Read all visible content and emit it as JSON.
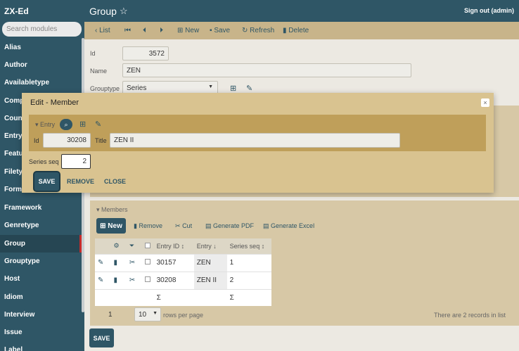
{
  "sidebar": {
    "brand": "ZX-Ed",
    "search_placeholder": "Search modules",
    "items": [
      {
        "label": "Alias"
      },
      {
        "label": "Author"
      },
      {
        "label": "Availabletype"
      },
      {
        "label": "Compa"
      },
      {
        "label": "Counti"
      },
      {
        "label": "Entry"
      },
      {
        "label": "Featu"
      },
      {
        "label": "Filetyp"
      },
      {
        "label": "Forma"
      },
      {
        "label": "Framework"
      },
      {
        "label": "Genretype"
      },
      {
        "label": "Group",
        "active": true
      },
      {
        "label": "Grouptype"
      },
      {
        "label": "Host"
      },
      {
        "label": "Idiom"
      },
      {
        "label": "Interview"
      },
      {
        "label": "Issue"
      },
      {
        "label": "Label"
      }
    ]
  },
  "header": {
    "title": "Group",
    "star": "☆",
    "signout": "Sign out (admin)"
  },
  "toolbar": {
    "list": "List",
    "new": "New",
    "save": "Save",
    "refresh": "Refresh",
    "delete": "Delete"
  },
  "form": {
    "id_label": "Id",
    "id_value": "3572",
    "name_label": "Name",
    "name_value": "ZEN",
    "grouptype_label": "Grouptype",
    "grouptype_value": "Series"
  },
  "dialog": {
    "title": "Edit - Member",
    "close": "×",
    "entry_label": "Entry",
    "id_label": "Id",
    "id_value": "30208",
    "title_label": "Title",
    "title_value": "ZEN II",
    "seriesseq_label": "Series seq",
    "seriesseq_value": "2",
    "save": "SAVE",
    "remove": "REMOVE",
    "close_btn": "CLOSE"
  },
  "members": {
    "heading": "Members",
    "new": "New",
    "remove": "Remove",
    "cut": "Cut",
    "pdf": "Generate PDF",
    "excel": "Generate Excel",
    "columns": {
      "entry_id": "Entry ID",
      "entry": "Entry",
      "series_seq": "Series seq"
    },
    "rows": [
      {
        "entry_id": "30157",
        "entry": "ZEN",
        "series_seq": "1"
      },
      {
        "entry_id": "30208",
        "entry": "ZEN II",
        "series_seq": "2"
      }
    ],
    "sum_symbol": "Σ",
    "page": "1",
    "rows_per_page": "10",
    "rows_per_page_label": "rows per page",
    "records_info": "There are 2 records in list"
  },
  "footer": {
    "save": "SAVE"
  },
  "colors": {
    "primary": "#2f5666",
    "panel": "#d7c8a6",
    "dialog": "#d9c390",
    "active_marker": "#c62b2b"
  }
}
